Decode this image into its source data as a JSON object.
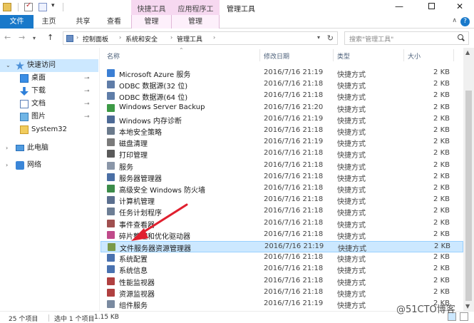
{
  "titlebar": {
    "ctx_tab_1": "快捷工具",
    "ctx_tab_2": "应用程序工具",
    "window_title": "管理工具",
    "qa_dropdown": "▾",
    "min": "—",
    "close": "✕"
  },
  "ribbon": {
    "tabs": [
      "文件",
      "主页",
      "共享",
      "查看",
      "管理",
      "管理"
    ],
    "help": "?",
    "collapse": "∧"
  },
  "address": {
    "crumbs": [
      "控制面板",
      "系统和安全",
      "管理工具"
    ],
    "search_placeholder": "搜索\"管理工具\""
  },
  "navpane": {
    "items": [
      {
        "label": "快速访问",
        "icon": "star-icon",
        "pinned": false
      },
      {
        "label": "桌面",
        "icon": "desktop-icon",
        "pinned": true
      },
      {
        "label": "下载",
        "icon": "download-icon",
        "pinned": true
      },
      {
        "label": "文档",
        "icon": "document-icon",
        "pinned": true
      },
      {
        "label": "图片",
        "icon": "picture-icon",
        "pinned": true
      },
      {
        "label": "System32",
        "icon": "folder-icon",
        "pinned": false
      },
      {
        "label": "此电脑",
        "icon": "computer-icon",
        "pinned": false
      },
      {
        "label": "网络",
        "icon": "network-icon",
        "pinned": false
      }
    ],
    "pin_glyph": "⊸"
  },
  "columns": {
    "name": "名称",
    "date": "修改日期",
    "type": "类型",
    "size": "大小"
  },
  "files": [
    {
      "name": "Microsoft Azure 服务",
      "date": "2016/7/16 21:19",
      "type": "快捷方式",
      "size": "2 KB",
      "color": "#3b7fd4"
    },
    {
      "name": "ODBC 数据源(32 位)",
      "date": "2016/7/16 21:18",
      "type": "快捷方式",
      "size": "2 KB",
      "color": "#5f7da8"
    },
    {
      "name": "ODBC 数据源(64 位)",
      "date": "2016/7/16 21:18",
      "type": "快捷方式",
      "size": "2 KB",
      "color": "#5f7da8"
    },
    {
      "name": "Windows Server Backup",
      "date": "2016/7/16 21:20",
      "type": "快捷方式",
      "size": "2 KB",
      "color": "#3d9a46"
    },
    {
      "name": "Windows 内存诊断",
      "date": "2016/7/16 21:19",
      "type": "快捷方式",
      "size": "2 KB",
      "color": "#4d6a96"
    },
    {
      "name": "本地安全策略",
      "date": "2016/7/16 21:18",
      "type": "快捷方式",
      "size": "2 KB",
      "color": "#6b7a8c"
    },
    {
      "name": "磁盘清理",
      "date": "2016/7/16 21:19",
      "type": "快捷方式",
      "size": "2 KB",
      "color": "#7a7a7a"
    },
    {
      "name": "打印管理",
      "date": "2016/7/16 21:18",
      "type": "快捷方式",
      "size": "2 KB",
      "color": "#5a5a5a"
    },
    {
      "name": "服务",
      "date": "2016/7/16 21:18",
      "type": "快捷方式",
      "size": "2 KB",
      "color": "#8a96a8"
    },
    {
      "name": "服务器管理器",
      "date": "2016/7/16 21:18",
      "type": "快捷方式",
      "size": "2 KB",
      "color": "#4a6fa5"
    },
    {
      "name": "高级安全 Windows 防火墙",
      "date": "2016/7/16 21:18",
      "type": "快捷方式",
      "size": "2 KB",
      "color": "#3c8c4a"
    },
    {
      "name": "计算机管理",
      "date": "2016/7/16 21:18",
      "type": "快捷方式",
      "size": "2 KB",
      "color": "#5b6f8f"
    },
    {
      "name": "任务计划程序",
      "date": "2016/7/16 21:18",
      "type": "快捷方式",
      "size": "2 KB",
      "color": "#6d7e95"
    },
    {
      "name": "事件查看器",
      "date": "2016/7/16 21:18",
      "type": "快捷方式",
      "size": "2 KB",
      "color": "#a05050"
    },
    {
      "name": "碎片整理和优化驱动器",
      "date": "2016/7/16 21:18",
      "type": "快捷方式",
      "size": "2 KB",
      "color": "#c04a8a"
    },
    {
      "name": "文件服务器资源管理器",
      "date": "2016/7/16 21:19",
      "type": "快捷方式",
      "size": "2 KB",
      "color": "#7a9a4a",
      "highlighted": true
    },
    {
      "name": "系统配置",
      "date": "2016/7/16 21:18",
      "type": "快捷方式",
      "size": "2 KB",
      "color": "#4a72b0"
    },
    {
      "name": "系统信息",
      "date": "2016/7/16 21:18",
      "type": "快捷方式",
      "size": "2 KB",
      "color": "#4a72b0"
    },
    {
      "name": "性能监视器",
      "date": "2016/7/16 21:18",
      "type": "快捷方式",
      "size": "2 KB",
      "color": "#b04040"
    },
    {
      "name": "资源监视器",
      "date": "2016/7/16 21:18",
      "type": "快捷方式",
      "size": "2 KB",
      "color": "#b04040"
    },
    {
      "name": "组件服务",
      "date": "2016/7/16 21:19",
      "type": "快捷方式",
      "size": "2 KB",
      "color": "#7a8aa0"
    }
  ],
  "statusbar": {
    "count": "25 个项目",
    "selected": "选中 1 个项目",
    "size": "1.15 KB"
  },
  "watermark": "@51CTO博客",
  "accent": "#1979ca",
  "annotation_color": "#e0202f"
}
